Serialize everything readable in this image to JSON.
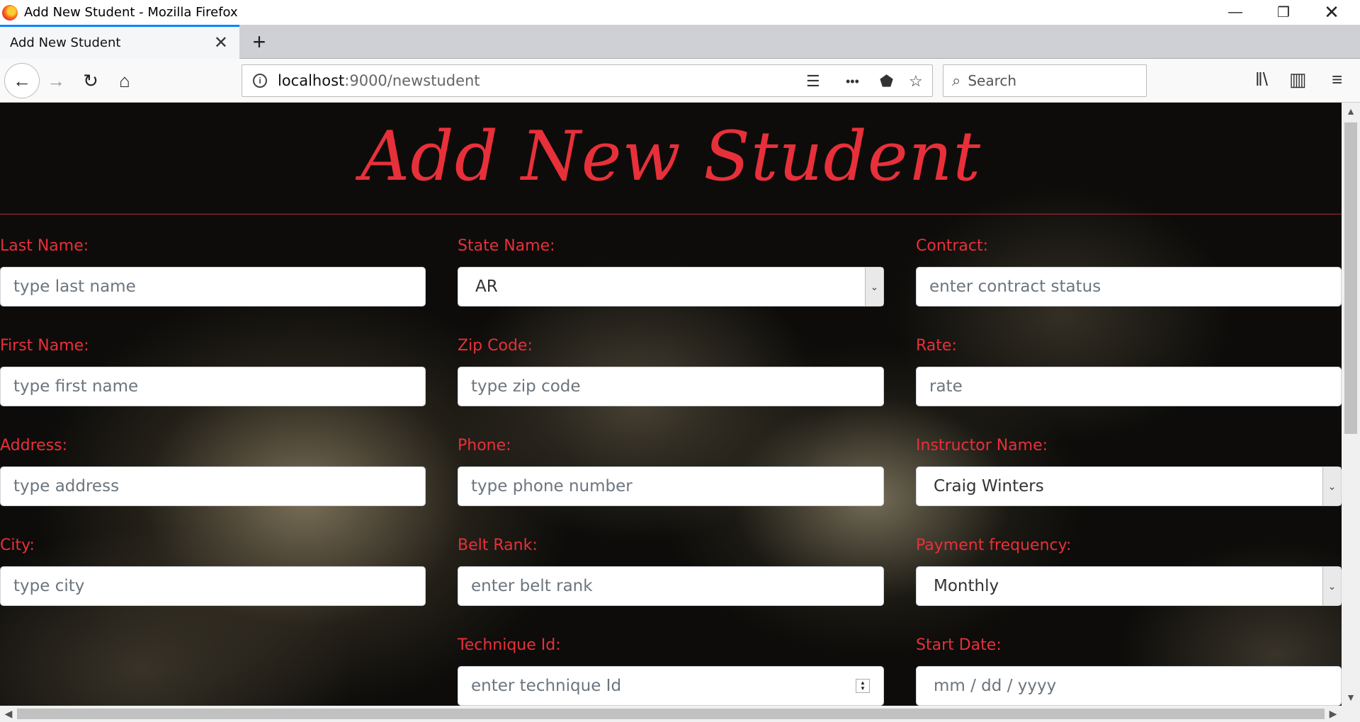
{
  "window": {
    "title": "Add New Student - Mozilla Firefox",
    "minimize_icon": "minimize-icon",
    "restore_icon": "restore-icon",
    "close_icon": "close-icon"
  },
  "tabs": [
    {
      "label": "Add New Student",
      "active": true
    }
  ],
  "toolbar": {
    "url_host": "localhost",
    "url_rest": ":9000/newstudent",
    "search_placeholder": "Search",
    "more_label": "•••"
  },
  "page": {
    "title": "Add New Student",
    "accent_color": "#e8303a",
    "fields": {
      "last_name": {
        "label": "Last Name:",
        "placeholder": "type last name"
      },
      "first_name": {
        "label": "First Name:",
        "placeholder": "type first name"
      },
      "address": {
        "label": "Address:",
        "placeholder": "type address"
      },
      "city": {
        "label": "City:",
        "placeholder": "type city"
      },
      "state_name": {
        "label": "State Name:",
        "value": "AR"
      },
      "zip_code": {
        "label": "Zip Code:",
        "placeholder": "type zip code"
      },
      "phone": {
        "label": "Phone:",
        "placeholder": "type phone number"
      },
      "belt_rank": {
        "label": "Belt Rank:",
        "placeholder": "enter belt rank"
      },
      "technique_id": {
        "label": "Technique Id:",
        "placeholder": "enter technique Id"
      },
      "contract": {
        "label": "Contract:",
        "placeholder": "enter contract status"
      },
      "rate": {
        "label": "Rate:",
        "placeholder": "rate"
      },
      "instructor_name": {
        "label": "Instructor Name:",
        "value": "Craig Winters"
      },
      "payment_frequency": {
        "label": "Payment frequency:",
        "value": "Monthly"
      },
      "start_date": {
        "label": "Start Date:",
        "placeholder": "mm / dd / yyyy"
      }
    }
  }
}
